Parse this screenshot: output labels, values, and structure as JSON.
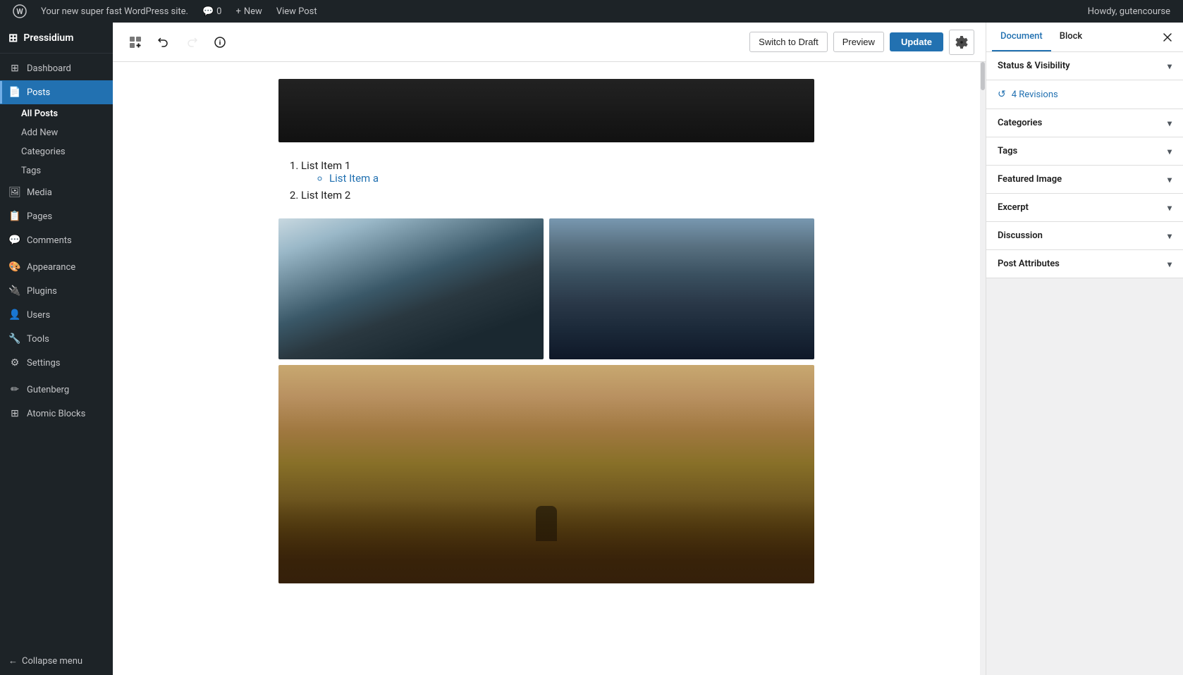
{
  "adminbar": {
    "site_name": "Your new super fast WordPress site.",
    "comments_count": "0",
    "new_label": "New",
    "view_post_label": "View Post",
    "howdy": "Howdy, gutencourse"
  },
  "sidebar": {
    "brand": "Pressidium",
    "items": [
      {
        "id": "dashboard",
        "label": "Dashboard",
        "icon": "⊞"
      },
      {
        "id": "posts",
        "label": "Posts",
        "icon": "📄",
        "active": true
      },
      {
        "id": "media",
        "label": "Media",
        "icon": "🖼"
      },
      {
        "id": "pages",
        "label": "Pages",
        "icon": "📋"
      },
      {
        "id": "comments",
        "label": "Comments",
        "icon": "💬"
      },
      {
        "id": "appearance",
        "label": "Appearance",
        "icon": "🎨"
      },
      {
        "id": "plugins",
        "label": "Plugins",
        "icon": "🔌"
      },
      {
        "id": "users",
        "label": "Users",
        "icon": "👤"
      },
      {
        "id": "tools",
        "label": "Tools",
        "icon": "🔧"
      },
      {
        "id": "settings",
        "label": "Settings",
        "icon": "⚙"
      },
      {
        "id": "gutenberg",
        "label": "Gutenberg",
        "icon": "✏"
      },
      {
        "id": "atomic-blocks",
        "label": "Atomic Blocks",
        "icon": "⊞"
      }
    ],
    "posts_sub": [
      {
        "id": "all-posts",
        "label": "All Posts",
        "active": true
      },
      {
        "id": "add-new",
        "label": "Add New"
      },
      {
        "id": "categories",
        "label": "Categories"
      },
      {
        "id": "tags",
        "label": "Tags"
      }
    ],
    "collapse_label": "Collapse menu"
  },
  "toolbar": {
    "add_block_title": "Add block",
    "undo_title": "Undo",
    "redo_title": "Redo",
    "info_title": "Information",
    "switch_draft_label": "Switch to Draft",
    "preview_label": "Preview",
    "update_label": "Update",
    "settings_title": "Settings"
  },
  "editor": {
    "list_items": [
      {
        "text": "List Item 1",
        "type": "ordered"
      },
      {
        "text": "List Item a",
        "type": "bullet",
        "nested": true
      },
      {
        "text": "List Item 2",
        "type": "ordered"
      }
    ]
  },
  "right_panel": {
    "document_tab": "Document",
    "block_tab": "Block",
    "close_title": "Close settings",
    "sections": [
      {
        "id": "status-visibility",
        "label": "Status & Visibility"
      },
      {
        "id": "categories",
        "label": "Categories"
      },
      {
        "id": "tags",
        "label": "Tags"
      },
      {
        "id": "featured-image",
        "label": "Featured Image"
      },
      {
        "id": "excerpt",
        "label": "Excerpt"
      },
      {
        "id": "discussion",
        "label": "Discussion"
      },
      {
        "id": "post-attributes",
        "label": "Post Attributes"
      }
    ],
    "revisions": {
      "icon": "↺",
      "label": "4 Revisions"
    }
  }
}
